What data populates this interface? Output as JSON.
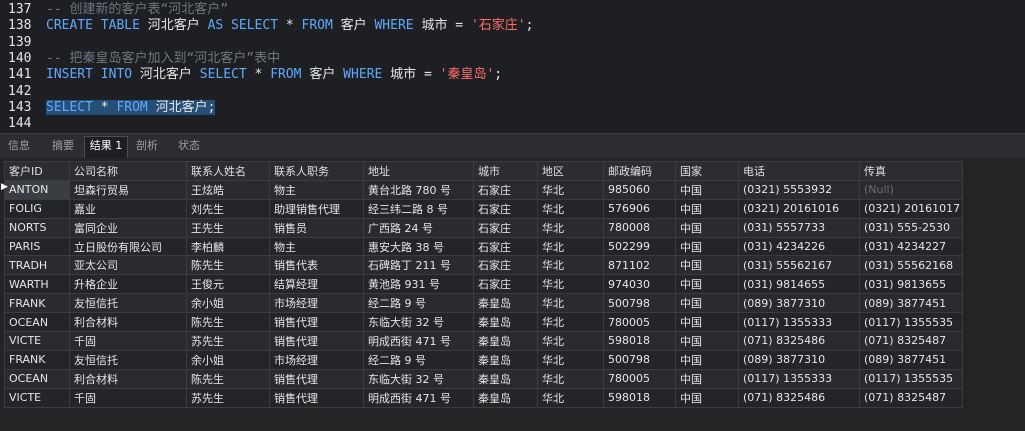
{
  "editor": {
    "lines": [
      {
        "num": "137",
        "cm": "-- 创建新的客户表“河北客户”"
      },
      {
        "num": "138",
        "code": [
          {
            "t": "kw",
            "v": "CREATE TABLE"
          },
          {
            "t": "tx",
            "v": " 河北客户 "
          },
          {
            "t": "kw",
            "v": "AS SELECT"
          },
          {
            "t": "tx",
            "v": " * "
          },
          {
            "t": "kw",
            "v": "FROM"
          },
          {
            "t": "tx",
            "v": " 客户 "
          },
          {
            "t": "kw",
            "v": "WHERE"
          },
          {
            "t": "tx",
            "v": " 城市 = "
          },
          {
            "t": "str",
            "v": "'石家庄'"
          },
          {
            "t": "tx",
            "v": ";"
          }
        ]
      },
      {
        "num": "139"
      },
      {
        "num": "140",
        "cm": "-- 把秦皇岛客户加入到“河北客户”表中"
      },
      {
        "num": "141",
        "code": [
          {
            "t": "kw",
            "v": "INSERT INTO"
          },
          {
            "t": "tx",
            "v": " 河北客户 "
          },
          {
            "t": "kw",
            "v": "SELECT"
          },
          {
            "t": "tx",
            "v": " * "
          },
          {
            "t": "kw",
            "v": "FROM"
          },
          {
            "t": "tx",
            "v": " 客户 "
          },
          {
            "t": "kw",
            "v": "WHERE"
          },
          {
            "t": "tx",
            "v": " 城市 = "
          },
          {
            "t": "str",
            "v": "'秦皇岛'"
          },
          {
            "t": "tx",
            "v": ";"
          }
        ]
      },
      {
        "num": "142"
      },
      {
        "num": "143",
        "selected": true,
        "code": [
          {
            "t": "kw",
            "v": "SELECT"
          },
          {
            "t": "tx",
            "v": " * "
          },
          {
            "t": "kw",
            "v": "FROM"
          },
          {
            "t": "tx",
            "v": " 河北客户;"
          }
        ]
      },
      {
        "num": "144"
      }
    ]
  },
  "tabs": [
    "信息",
    "摘要",
    "结果 1",
    "剖析",
    "状态"
  ],
  "active_tab": 2,
  "grid": {
    "columns": [
      "客户ID",
      "公司名称",
      "联系人姓名",
      "联系人职务",
      "地址",
      "城市",
      "地区",
      "邮政编码",
      "国家",
      "电话",
      "传真"
    ],
    "rows": [
      [
        "ANTON",
        "坦森行贸易",
        "王炫皓",
        "物主",
        "黄台北路 780 号",
        "石家庄",
        "华北",
        "985060",
        "中国",
        "(0321) 5553932",
        "(Null)"
      ],
      [
        "FOLIG",
        "嘉业",
        "刘先生",
        "助理销售代理",
        "经三纬二路 8 号",
        "石家庄",
        "华北",
        "576906",
        "中国",
        "(0321) 20161016",
        "(0321) 20161017"
      ],
      [
        "NORTS",
        "富同企业",
        "王先生",
        "销售员",
        "广西路 24 号",
        "石家庄",
        "华北",
        "780008",
        "中国",
        "(031) 5557733",
        "(031) 555-2530"
      ],
      [
        "PARIS",
        "立日股份有限公司",
        "李柏麟",
        "物主",
        "惠安大路 38 号",
        "石家庄",
        "华北",
        "502299",
        "中国",
        "(031) 4234226",
        "(031) 4234227"
      ],
      [
        "TRADH",
        "亚太公司",
        "陈先生",
        "销售代表",
        "石碑路丁 211 号",
        "石家庄",
        "华北",
        "871102",
        "中国",
        "(031) 55562167",
        "(031) 55562168"
      ],
      [
        "WARTH",
        "升格企业",
        "王俊元",
        "结算经理",
        "黄池路 931 号",
        "石家庄",
        "华北",
        "974030",
        "中国",
        "(031) 9814655",
        "(031) 9813655"
      ],
      [
        "FRANK",
        "友恒信托",
        "余小姐",
        "市场经理",
        "经二路 9 号",
        "秦皇岛",
        "华北",
        "500798",
        "中国",
        "(089) 3877310",
        "(089) 3877451"
      ],
      [
        "OCEAN",
        "利合材料",
        "陈先生",
        "销售代理",
        "东临大街 32 号",
        "秦皇岛",
        "华北",
        "780005",
        "中国",
        "(0117) 1355333",
        "(0117) 1355535"
      ],
      [
        "VICTE",
        "千固",
        "苏先生",
        "销售代理",
        "明成西街 471 号",
        "秦皇岛",
        "华北",
        "598018",
        "中国",
        "(071) 8325486",
        "(071) 8325487"
      ],
      [
        "FRANK",
        "友恒信托",
        "余小姐",
        "市场经理",
        "经二路 9 号",
        "秦皇岛",
        "华北",
        "500798",
        "中国",
        "(089) 3877310",
        "(089) 3877451"
      ],
      [
        "OCEAN",
        "利合材料",
        "陈先生",
        "销售代理",
        "东临大街 32 号",
        "秦皇岛",
        "华北",
        "780005",
        "中国",
        "(0117) 1355333",
        "(0117) 1355535"
      ],
      [
        "VICTE",
        "千固",
        "苏先生",
        "销售代理",
        "明成西街 471 号",
        "秦皇岛",
        "华北",
        "598018",
        "中国",
        "(071) 8325486",
        "(071) 8325487"
      ]
    ],
    "null_text": "(Null)"
  },
  "colors": {
    "keyword": "#5fa9ff",
    "string": "#ff6d6d",
    "comment": "#6f7680",
    "selection": "#264f78"
  }
}
